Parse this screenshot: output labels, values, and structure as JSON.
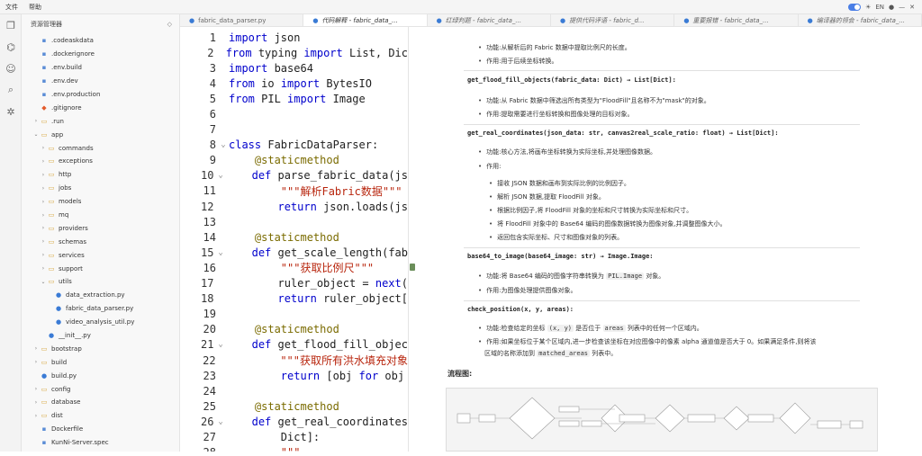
{
  "menu": {
    "file": "文件",
    "help": "帮助"
  },
  "explorer": {
    "title": "资源管理器",
    "items": [
      {
        "label": ".codeaskdata",
        "indent": 1,
        "kind": "file",
        "arrow": ""
      },
      {
        "label": ".dockerignore",
        "indent": 1,
        "kind": "file",
        "arrow": ""
      },
      {
        "label": ".env.build",
        "indent": 1,
        "kind": "file",
        "arrow": ""
      },
      {
        "label": ".env.dev",
        "indent": 1,
        "kind": "file",
        "arrow": ""
      },
      {
        "label": ".env.production",
        "indent": 1,
        "kind": "file",
        "arrow": ""
      },
      {
        "label": ".gitignore",
        "indent": 1,
        "kind": "git",
        "arrow": ""
      },
      {
        "label": ".run",
        "indent": 1,
        "kind": "folder",
        "arrow": "›"
      },
      {
        "label": "app",
        "indent": 1,
        "kind": "folder",
        "arrow": "⌄"
      },
      {
        "label": "commands",
        "indent": 2,
        "kind": "folder",
        "arrow": "›"
      },
      {
        "label": "exceptions",
        "indent": 2,
        "kind": "folder",
        "arrow": "›"
      },
      {
        "label": "http",
        "indent": 2,
        "kind": "folder",
        "arrow": "›"
      },
      {
        "label": "jobs",
        "indent": 2,
        "kind": "folder",
        "arrow": "›"
      },
      {
        "label": "models",
        "indent": 2,
        "kind": "folder",
        "arrow": "›"
      },
      {
        "label": "mq",
        "indent": 2,
        "kind": "folder",
        "arrow": "›"
      },
      {
        "label": "providers",
        "indent": 2,
        "kind": "folder",
        "arrow": "›"
      },
      {
        "label": "schemas",
        "indent": 2,
        "kind": "folder",
        "arrow": "›"
      },
      {
        "label": "services",
        "indent": 2,
        "kind": "folder",
        "arrow": "›"
      },
      {
        "label": "support",
        "indent": 2,
        "kind": "folder",
        "arrow": "›"
      },
      {
        "label": "utils",
        "indent": 2,
        "kind": "folder",
        "arrow": "⌄"
      },
      {
        "label": "data_extraction.py",
        "indent": 3,
        "kind": "py",
        "arrow": ""
      },
      {
        "label": "fabric_data_parser.py",
        "indent": 3,
        "kind": "py",
        "arrow": ""
      },
      {
        "label": "video_analysis_util.py",
        "indent": 3,
        "kind": "py",
        "arrow": ""
      },
      {
        "label": "__init__.py",
        "indent": 2,
        "kind": "py",
        "arrow": ""
      },
      {
        "label": "bootstrap",
        "indent": 1,
        "kind": "folder",
        "arrow": "›"
      },
      {
        "label": "build",
        "indent": 1,
        "kind": "folder",
        "arrow": "›"
      },
      {
        "label": "build.py",
        "indent": 1,
        "kind": "py",
        "arrow": ""
      },
      {
        "label": "config",
        "indent": 1,
        "kind": "folder",
        "arrow": "›"
      },
      {
        "label": "database",
        "indent": 1,
        "kind": "folder",
        "arrow": "›"
      },
      {
        "label": "dist",
        "indent": 1,
        "kind": "folder",
        "arrow": "›"
      },
      {
        "label": "Dockerfile",
        "indent": 1,
        "kind": "file",
        "arrow": ""
      },
      {
        "label": "KunNi-Server.spec",
        "indent": 1,
        "kind": "file",
        "arrow": ""
      }
    ]
  },
  "tabs": [
    {
      "label": "fabric_data_parser.py",
      "active": false
    },
    {
      "label": "代码解释 - fabric_data_...",
      "active": true
    },
    {
      "label": "红绿判题 - fabric_data_...",
      "active": false
    },
    {
      "label": "提供代码评语 - fabric_d...",
      "active": false
    },
    {
      "label": "重要报错 - fabric_data_...",
      "active": false
    },
    {
      "label": "编译器的领会 - fabric_data_...",
      "active": false
    }
  ],
  "code": [
    {
      "n": "1",
      "fold": "",
      "tokens": [
        [
          "kw",
          "import"
        ],
        [
          "code",
          " json"
        ]
      ]
    },
    {
      "n": "2",
      "fold": "",
      "tokens": [
        [
          "kw",
          "from"
        ],
        [
          "code",
          " typing "
        ],
        [
          "kw",
          "import"
        ],
        [
          "code",
          " List, Dic"
        ]
      ]
    },
    {
      "n": "3",
      "fold": "",
      "tokens": [
        [
          "kw",
          "import"
        ],
        [
          "code",
          " base64"
        ]
      ]
    },
    {
      "n": "4",
      "fold": "",
      "tokens": [
        [
          "kw",
          "from"
        ],
        [
          "code",
          " io "
        ],
        [
          "kw",
          "import"
        ],
        [
          "code",
          " BytesIO"
        ]
      ]
    },
    {
      "n": "5",
      "fold": "",
      "tokens": [
        [
          "kw",
          "from"
        ],
        [
          "code",
          " PIL "
        ],
        [
          "kw",
          "import"
        ],
        [
          "code",
          " Image"
        ]
      ]
    },
    {
      "n": "6",
      "fold": "",
      "tokens": []
    },
    {
      "n": "7",
      "fold": "",
      "tokens": []
    },
    {
      "n": "8",
      "fold": "⌄",
      "tokens": [
        [
          "kw",
          "class"
        ],
        [
          "code",
          " FabricDataParser:"
        ]
      ]
    },
    {
      "n": "9",
      "fold": "",
      "tokens": [
        [
          "code",
          "    "
        ],
        [
          "deco",
          "@staticmethod"
        ]
      ]
    },
    {
      "n": "10",
      "fold": "⌄",
      "tokens": [
        [
          "code",
          "    "
        ],
        [
          "kw",
          "def"
        ],
        [
          "code",
          " parse_fabric_data(js"
        ]
      ]
    },
    {
      "n": "11",
      "fold": "",
      "tokens": [
        [
          "code",
          "        "
        ],
        [
          "str",
          "\"\"\"解析Fabric数据\"\"\""
        ]
      ]
    },
    {
      "n": "12",
      "fold": "",
      "tokens": [
        [
          "code",
          "        "
        ],
        [
          "kw",
          "return"
        ],
        [
          "code",
          " json.loads(js"
        ]
      ]
    },
    {
      "n": "13",
      "fold": "",
      "tokens": []
    },
    {
      "n": "14",
      "fold": "",
      "tokens": [
        [
          "code",
          "    "
        ],
        [
          "deco",
          "@staticmethod"
        ]
      ]
    },
    {
      "n": "15",
      "fold": "⌄",
      "tokens": [
        [
          "code",
          "    "
        ],
        [
          "kw",
          "def"
        ],
        [
          "code",
          " get_scale_length(fab"
        ]
      ]
    },
    {
      "n": "16",
      "fold": "",
      "tokens": [
        [
          "code",
          "        "
        ],
        [
          "str",
          "\"\"\"获取比例尺\"\"\""
        ]
      ]
    },
    {
      "n": "17",
      "fold": "",
      "tokens": [
        [
          "code",
          "        ruler_object = "
        ],
        [
          "kw",
          "next"
        ],
        [
          "code",
          "("
        ]
      ]
    },
    {
      "n": "18",
      "fold": "",
      "tokens": [
        [
          "code",
          "        "
        ],
        [
          "kw",
          "return"
        ],
        [
          "code",
          " ruler_object["
        ]
      ]
    },
    {
      "n": "19",
      "fold": "",
      "tokens": []
    },
    {
      "n": "20",
      "fold": "",
      "tokens": [
        [
          "code",
          "    "
        ],
        [
          "deco",
          "@staticmethod"
        ]
      ]
    },
    {
      "n": "21",
      "fold": "⌄",
      "tokens": [
        [
          "code",
          "    "
        ],
        [
          "kw",
          "def"
        ],
        [
          "code",
          " get_flood_fill_objec"
        ]
      ]
    },
    {
      "n": "22",
      "fold": "",
      "tokens": [
        [
          "code",
          "        "
        ],
        [
          "str",
          "\"\"\"获取所有洪水填充对象"
        ]
      ]
    },
    {
      "n": "23",
      "fold": "",
      "tokens": [
        [
          "code",
          "        "
        ],
        [
          "kw",
          "return"
        ],
        [
          "code",
          " [obj "
        ],
        [
          "kw",
          "for"
        ],
        [
          "code",
          " obj"
        ]
      ]
    },
    {
      "n": "24",
      "fold": "",
      "tokens": []
    },
    {
      "n": "25",
      "fold": "",
      "tokens": [
        [
          "code",
          "    "
        ],
        [
          "deco",
          "@staticmethod"
        ]
      ]
    },
    {
      "n": "26",
      "fold": "⌄",
      "tokens": [
        [
          "code",
          "    "
        ],
        [
          "kw",
          "def"
        ],
        [
          "code",
          " get_real_coordinates"
        ]
      ]
    },
    {
      "n": "27",
      "fold": "",
      "tokens": [
        [
          "code",
          "        Dict]:"
        ]
      ]
    },
    {
      "n": "28",
      "fold": "",
      "tokens": [
        [
          "code",
          "        "
        ],
        [
          "str",
          "\"\"\""
        ]
      ]
    }
  ],
  "preview": {
    "b1": "功能:从解析后的 Fabric 数据中提取比例尺的长度。",
    "b2": "作用:用于后续坐标转换。",
    "h1": "get_flood_fill_objects(fabric_data: Dict) → List[Dict]:",
    "b3": "功能:从 Fabric 数据中筛选出所有类型为\"FloodFill\"且名称不为\"mask\"的对象。",
    "b4": "作用:提取需要进行坐标转换和图像处理的目标对象。",
    "h2": "get_real_coordinates(json_data: str, canvas2real_scale_ratio: float) → List[Dict]:",
    "b5": "功能:核心方法,将画布坐标转换为实际坐标,并处理图像数据。",
    "b6": "作用:",
    "s1": "接收 JSON 数据和画布到实际比例的比例因子。",
    "s2": "解析 JSON 数据,提取 FloodFill 对象。",
    "s3": "根据比例因子,将 FloodFill 对象的坐标和尺寸转换为实际坐标和尺寸。",
    "s4": "将 FloodFill 对象中的 Base64 编码的图像数据转换为图像对象,并调整图像大小。",
    "s5": "返回包含实际坐标、尺寸和图像对象的列表。",
    "h3": "base64_to_image(base64_image: str) → Image.Image:",
    "b7a": "功能:将 Base64 编码的图像字符串转换为",
    "b7code": "PIL.Image",
    "b7b": "对象。",
    "b8": "作用:为图像处理提供图像对象。",
    "h4": "check_position(x, y, areas):",
    "b9a": "功能:检查给定的坐标",
    "b9code1": "(x, y)",
    "b9b": "是否位于",
    "b9code2": "areas",
    "b9c": "列表中的任何一个区域内。",
    "b10a": "作用:如果坐标位于某个区域内,进一步检查该坐标在对应图像中的像素 alpha 通道值是否大于 0。如果满足条件,则将该",
    "b10b": "区域的名称添加到",
    "b10code": "matched_areas",
    "b10c": "列表中。",
    "flow_title": "流程图:"
  }
}
